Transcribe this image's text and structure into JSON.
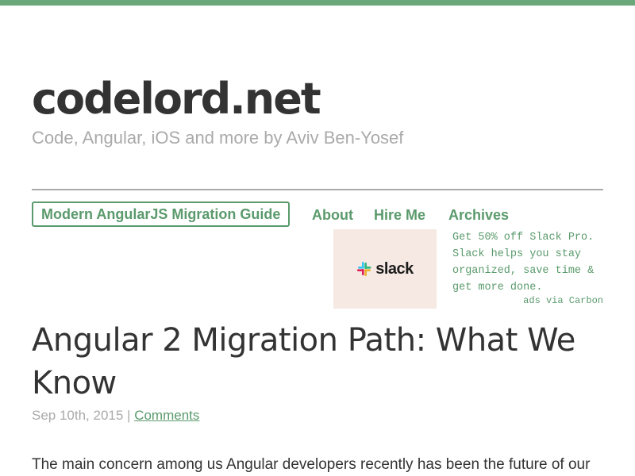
{
  "header": {
    "site_title": "codelord.net",
    "subtitle": "Code, Angular, iOS and more by Aviv Ben-Yosef"
  },
  "nav": {
    "guide_label": "Modern AngularJS Migration Guide",
    "about_label": "About",
    "hire_label": "Hire Me",
    "archives_label": "Archives"
  },
  "ad": {
    "brand": "slack",
    "text": "Get 50% off Slack Pro. Slack helps you stay organized, save time & get more done.",
    "credit": "ads via Carbon",
    "colors": {
      "background": "#f6e9e3",
      "logo_blue": "#36c5f0",
      "logo_green": "#2eb67d",
      "logo_yellow": "#ecb22e",
      "logo_red": "#e01e5a"
    }
  },
  "post": {
    "title": "Angular 2 Migration Path: What We Know",
    "date": "Sep 10th, 2015",
    "separator": " | ",
    "comments_label": "Comments",
    "excerpt": "The main concern among us Angular developers recently has been the future of our"
  },
  "theme": {
    "accent": "#6aa87a",
    "link": "#5a9a6c",
    "muted": "#aaaaaa",
    "text": "#333333"
  }
}
